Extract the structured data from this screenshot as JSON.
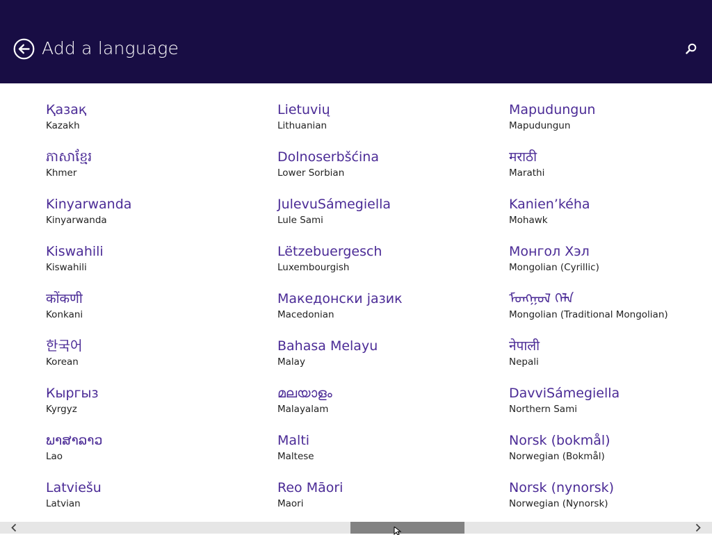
{
  "header": {
    "title": "Add a language",
    "back_icon": "back-arrow-circle-icon",
    "search_icon": "search-icon",
    "background_color": "#180d44"
  },
  "accent_color": "#4b2b96",
  "columns": [
    [
      {
        "native": "Қазақ",
        "english": "Kazakh"
      },
      {
        "native": "ភាសាខ្មែរ",
        "english": "Khmer"
      },
      {
        "native": "Kinyarwanda",
        "english": "Kinyarwanda"
      },
      {
        "native": "Kiswahili",
        "english": "Kiswahili"
      },
      {
        "native": "कोंकणी",
        "english": "Konkani"
      },
      {
        "native": "한국어",
        "english": "Korean"
      },
      {
        "native": "Кыргыз",
        "english": "Kyrgyz"
      },
      {
        "native": "ພາສາລາວ",
        "english": "Lao"
      },
      {
        "native": "Latviešu",
        "english": "Latvian"
      }
    ],
    [
      {
        "native": "Lietuvių",
        "english": "Lithuanian"
      },
      {
        "native": "Dolnoserbšćina",
        "english": "Lower Sorbian"
      },
      {
        "native": "JulevuSámegiella",
        "english": "Lule Sami"
      },
      {
        "native": "Lëtzebuergesch",
        "english": "Luxembourgish"
      },
      {
        "native": "Македонски јазик",
        "english": "Macedonian"
      },
      {
        "native": "Bahasa Melayu",
        "english": "Malay"
      },
      {
        "native": "മലയാളം",
        "english": "Malayalam"
      },
      {
        "native": "Malti",
        "english": "Maltese"
      },
      {
        "native": "Reo Māori",
        "english": "Maori"
      }
    ],
    [
      {
        "native": "Mapudungun",
        "english": "Mapudungun"
      },
      {
        "native": "मराठी",
        "english": "Marathi"
      },
      {
        "native": "Kanien’kéha",
        "english": "Mohawk"
      },
      {
        "native": "Монгол Хэл",
        "english": "Mongolian (Cyrillic)"
      },
      {
        "native": "ᠮᠣᠩᠭᠣᠯ ᠬᠡᠯᠡ",
        "english": "Mongolian (Traditional Mongolian)"
      },
      {
        "native": "नेपाली",
        "english": "Nepali"
      },
      {
        "native": "DavviSámegiella",
        "english": "Northern Sami"
      },
      {
        "native": "Norsk (bokmål)",
        "english": "Norwegian (Bokmål)"
      },
      {
        "native": "Norsk (nynorsk)",
        "english": "Norwegian (Nynorsk)"
      }
    ]
  ],
  "scrollbar": {
    "left_icon": "chevron-left-icon",
    "right_icon": "chevron-right-icon"
  }
}
